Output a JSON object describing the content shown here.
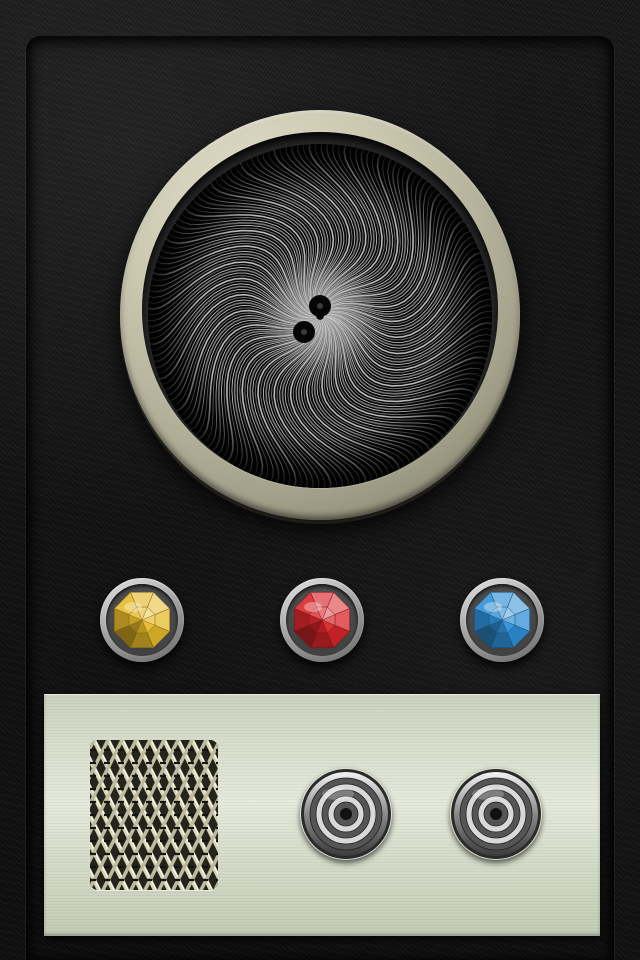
{
  "device": {
    "scanner": {
      "icon": "radial-scanner-icon",
      "bezel_color": "#c9c7ae",
      "screen_color": "#080808"
    },
    "gem_buttons": [
      {
        "id": "yellow",
        "icon": "yellow-gem-icon",
        "color": "#e6b92a"
      },
      {
        "id": "red",
        "icon": "red-gem-icon",
        "color": "#d8262a"
      },
      {
        "id": "blue",
        "icon": "blue-gem-icon",
        "color": "#2f8fd6"
      }
    ],
    "control_panel": {
      "panel_color": "#d6ddca",
      "speaker": {
        "icon": "speaker-grille-icon"
      },
      "dials": [
        {
          "id": "left",
          "icon": "dial-knob-icon"
        },
        {
          "id": "right",
          "icon": "dial-knob-icon"
        }
      ]
    }
  }
}
